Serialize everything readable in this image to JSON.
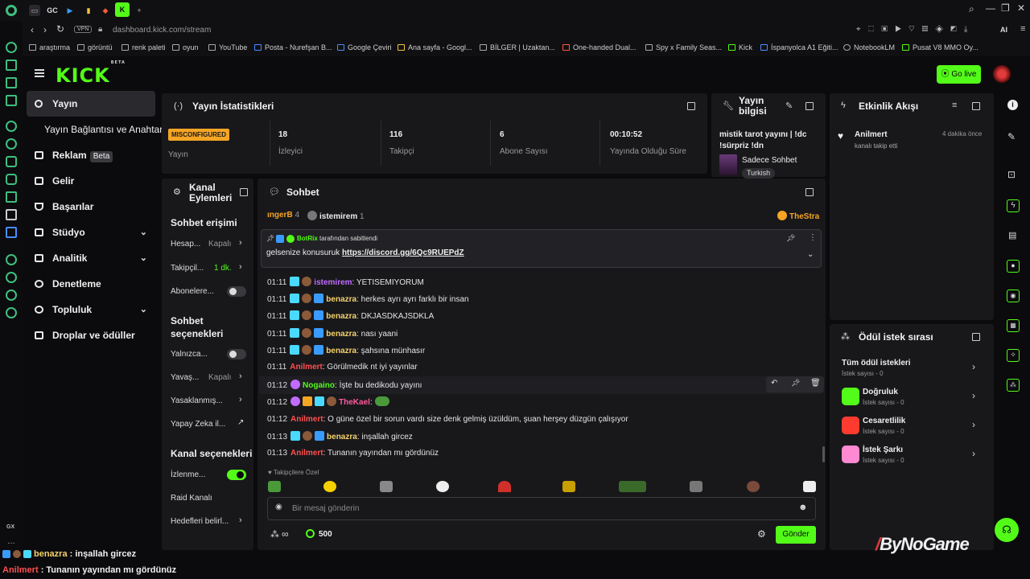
{
  "browser": {
    "tab_labels": [
      "GC"
    ],
    "url": "dashboard.kick.com/stream",
    "vpn": "VPN",
    "ai": "AI",
    "bookmarks": [
      "araştırma",
      "görüntü",
      "renk paleti",
      "oyun",
      "YouTube",
      "Posta - Nurefşan B...",
      "Google Çeviri",
      "Ana sayfa - Googl...",
      "BİLGER | Uzaktan...",
      "One-handed Dual...",
      "Spy x Family Seas...",
      "Kick",
      "İspanyolca A1 Eğiti...",
      "NotebookLM",
      "Pusat V8 MMO Oy..."
    ],
    "gx_label": "GX"
  },
  "header": {
    "logo": "KICK",
    "logo_sup": "BETA",
    "go_live": "Go live"
  },
  "nav": {
    "items": [
      {
        "label": "Yayın",
        "active": true
      },
      {
        "label": "Yayın Bağlantısı ve Anahtarı",
        "sub": true
      },
      {
        "label": "Reklam",
        "badge": "Beta"
      },
      {
        "label": "Gelir"
      },
      {
        "label": "Başarılar"
      },
      {
        "label": "Stüdyo",
        "chevron": "⌄"
      },
      {
        "label": "Analitik",
        "chevron": "⌄"
      },
      {
        "label": "Denetleme"
      },
      {
        "label": "Topluluk",
        "chevron": "⌄"
      },
      {
        "label": "Droplar ve ödüller"
      }
    ]
  },
  "stats": {
    "title": "Yayın İstatistikleri",
    "status": "MISCONFIGURED",
    "status_label": "Yayın",
    "items": [
      {
        "value": "18",
        "label": "İzleyici"
      },
      {
        "value": "116",
        "label": "Takipçi"
      },
      {
        "value": "6",
        "label": "Abone Sayısı"
      },
      {
        "value": "00:10:52",
        "label": "Yayında Olduğu Süre"
      }
    ]
  },
  "stream_info": {
    "title1": "Yayın",
    "title2": "bilgisi",
    "stream_title": "mistik tarot yayını | !dc",
    "stream_title2": "!sürpriz !dn",
    "category": "Sadece Sohbet",
    "language": "Turkish"
  },
  "activity": {
    "title": "Etkinlik Akışı",
    "user": "Anilmert",
    "time": "4 dakika önce",
    "text": "kanalı takip etti"
  },
  "channel_actions": {
    "title1": "Kanal",
    "title2": "Eylemleri",
    "chat_access": "Sohbet erişimi",
    "rows_access": [
      {
        "label": "Hesap...",
        "value": "Kapalı"
      },
      {
        "label": "Takipçil...",
        "value": "1 dk."
      },
      {
        "label": "Abonelere...",
        "toggle": false
      }
    ],
    "chat_options1": "Sohbet",
    "chat_options2": "seçenekleri",
    "rows_options": [
      {
        "label": "Yalnızca...",
        "toggle": false
      },
      {
        "label": "Yavaş...",
        "value": "Kapalı"
      },
      {
        "label": "Yasaklanmış..."
      },
      {
        "label": "Yapay Zeka il..."
      }
    ],
    "channel_options": "Kanal seçenekleri",
    "rows_channel": [
      {
        "label": "İzlenme...",
        "toggle": true
      },
      {
        "label": "Raid Kanalı"
      },
      {
        "label": "Hedefleri belirl..."
      }
    ]
  },
  "chat": {
    "title": "Sohbet",
    "top_users": [
      {
        "name": "ıngerB",
        "count": "4"
      },
      {
        "name": "istemirem",
        "count": "1"
      }
    ],
    "top_right": "TheStra",
    "pinned_by": "BotRix",
    "pinned_suffix": "tarafından sabitlendi",
    "pinned_text": "gelsenize konusuruk",
    "pinned_link": "https://discord.gg/6Qc9RUEPdZ",
    "messages": [
      {
        "time": "01:11",
        "user": "istemirem",
        "color": "#c26bff",
        "text": "YETISEMIYORUM"
      },
      {
        "time": "01:11",
        "user": "benazra",
        "color": "#f5d36b",
        "text": "herkes ayrı ayrı farklı bir insan"
      },
      {
        "time": "01:11",
        "user": "benazra",
        "color": "#f5d36b",
        "text": "DKJASDKAJSDKLA"
      },
      {
        "time": "01:11",
        "user": "benazra",
        "color": "#f5d36b",
        "text": "nası yaani"
      },
      {
        "time": "01:11",
        "user": "benazra",
        "color": "#f5d36b",
        "text": "şahsına münhasır"
      },
      {
        "time": "01:11",
        "user": "Anilmert",
        "color": "#ff4f4f",
        "text": "Görülmedik nt iyi yayınlar"
      },
      {
        "time": "01:12",
        "user": "Nogaino",
        "color": "#53fc18",
        "text": "İşte bu dedikodu yayını"
      },
      {
        "time": "01:12",
        "user": "TheKael",
        "color": "#ff5aa0",
        "text": ""
      },
      {
        "time": "01:12",
        "user": "Anilmert",
        "color": "#ff4f4f",
        "text": "O güne özel bir sorun vardı size denk gelmiş üzüldüm, şuan herşey düzgün çalışıyor"
      },
      {
        "time": "01:13",
        "user": "benazra",
        "color": "#f5d36b",
        "text": "inşallah gircez"
      },
      {
        "time": "01:13",
        "user": "Anilmert",
        "color": "#ff4f4f",
        "text": "Tunanın yayından mı gördünüz"
      }
    ],
    "emote_section": "Takipçilere Özel",
    "input_placeholder": "Bir mesaj gönderin",
    "points": "500",
    "send": "Gönder",
    "infinity": "∞"
  },
  "rewards": {
    "title": "Ödül istek sırası",
    "all_title": "Tüm ödül istekleri",
    "all_sub": "İstek sayısı - 0",
    "items": [
      {
        "title": "Doğruluk",
        "sub": "İstek sayısı - 0",
        "color": "#53fc18"
      },
      {
        "title": "Cesaretlilik",
        "sub": "İstek sayısı - 0",
        "color": "#ff3b30"
      },
      {
        "title": "İstek Şarkı",
        "sub": "İstek sayısı - 0",
        "color": "#ff8ad1"
      }
    ]
  },
  "overlay": {
    "brand": "ByNoGame",
    "lines": [
      {
        "user": "benazra",
        "color": "#f5d36b",
        "text": ": inşallah gircez"
      },
      {
        "user": "Anilmert",
        "color": "#ff4f4f",
        "text": ": Tunanın yayından mı gördünüz"
      }
    ]
  }
}
